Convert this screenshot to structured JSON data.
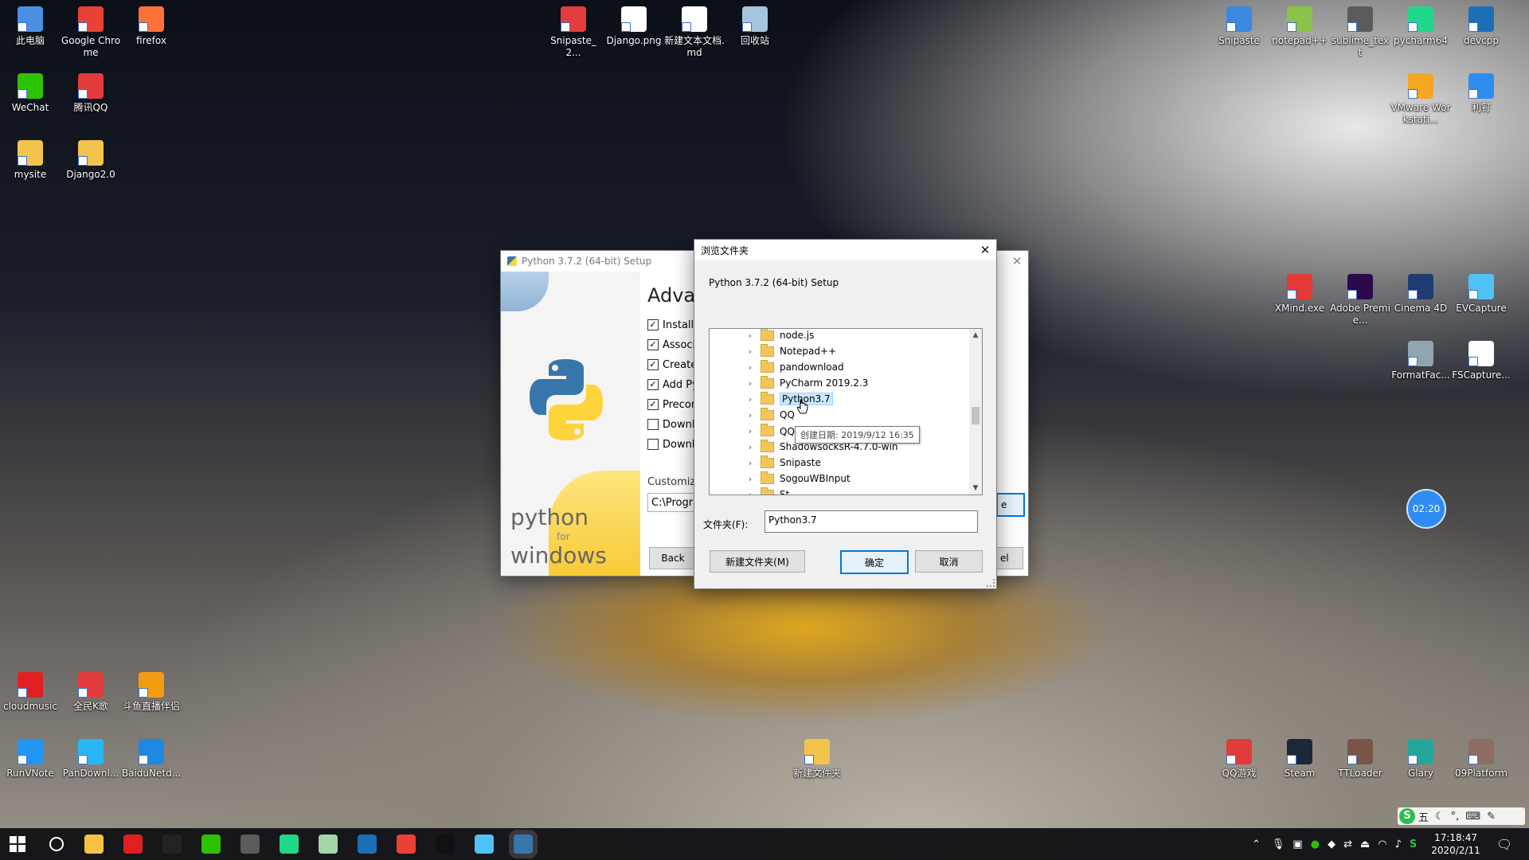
{
  "desktop": {
    "left_icons": [
      {
        "label": "此电脑",
        "color": "#4a90e2"
      },
      {
        "label": "Google Chrome",
        "color": "#e94235"
      },
      {
        "label": "firefox",
        "color": "#ff7139"
      },
      {
        "label": "WeChat",
        "color": "#2dc100"
      },
      {
        "label": "腾讯QQ",
        "color": "#e23b3b"
      },
      {
        "label": "mysite",
        "color": "#f2c44c"
      },
      {
        "label": "Django2.0",
        "color": "#f2c44c"
      }
    ],
    "center_icons": [
      {
        "label": "Snipaste_2...",
        "color": "#e33c3c"
      },
      {
        "label": "Django.png",
        "color": "#ffffff"
      },
      {
        "label": "新建文本文档.md",
        "color": "#ffffff"
      },
      {
        "label": "回收站",
        "color": "#a7c4de"
      }
    ],
    "right_top_icons": [
      {
        "label": "Snipaste",
        "color": "#3a88e0"
      },
      {
        "label": "notepad++",
        "color": "#8bc34a"
      },
      {
        "label": "sublime_text",
        "color": "#5b5b5b"
      },
      {
        "label": "pycharm64",
        "color": "#21d789"
      },
      {
        "label": "devcpp",
        "color": "#1b6fb5"
      },
      {
        "label": "VMware Workstati...",
        "color": "#f5a623"
      },
      {
        "label": "利钉",
        "color": "#2f8cf0"
      }
    ],
    "right_mid_icons": [
      {
        "label": "XMind.exe",
        "color": "#e53935"
      },
      {
        "label": "Adobe Premie...",
        "color": "#2a0a4a"
      },
      {
        "label": "Cinema 4D",
        "color": "#1e3c72"
      },
      {
        "label": "EVCapture",
        "color": "#4fc3f7"
      },
      {
        "label": "FormatFac...",
        "color": "#90a4ae"
      },
      {
        "label": "FSCapture...",
        "color": "#ffffff"
      }
    ],
    "bottom_left_icons": [
      {
        "label": "cloudmusic",
        "color": "#e02020"
      },
      {
        "label": "全民K歌",
        "color": "#e23b3b"
      },
      {
        "label": "斗鱼直播伴侣",
        "color": "#f39c12"
      },
      {
        "label": "RunVNote",
        "color": "#2196f3"
      },
      {
        "label": "PanDownl...",
        "color": "#29b6f6"
      },
      {
        "label": "BaiduNetd...",
        "color": "#1e88e5"
      }
    ],
    "bottom_mid_icons": [
      {
        "label": "新建文件夹",
        "color": "#f2c44c"
      }
    ],
    "bottom_right_icons": [
      {
        "label": "QQ游戏",
        "color": "#e23b3b"
      },
      {
        "label": "Steam",
        "color": "#1b2838"
      },
      {
        "label": "TTLoader",
        "color": "#795548"
      },
      {
        "label": "Glary",
        "color": "#26a69a"
      },
      {
        "label": "09Platform",
        "color": "#8d6e63"
      }
    ],
    "timer_badge": "02:20"
  },
  "setup_window": {
    "title": "Python 3.7.2 (64-bit) Setup",
    "heading": "Adva",
    "options": [
      {
        "label": "Install f",
        "checked": true
      },
      {
        "label": "Associa",
        "checked": true
      },
      {
        "label": "Create",
        "checked": true
      },
      {
        "label": "Add Py",
        "checked": true
      },
      {
        "label": "Precon",
        "checked": true
      },
      {
        "label": "Downlo",
        "checked": false
      },
      {
        "label": "Downlo",
        "checked": false
      }
    ],
    "custom_label": "Customiz",
    "path_value": "C:\\Progra",
    "back_button": "Back",
    "brand_python": "python",
    "brand_for": "for",
    "brand_windows": "windows",
    "right_btn1": "e",
    "right_btn2": "el"
  },
  "browse_dialog": {
    "title": "浏览文件夹",
    "description": "Python 3.7.2 (64-bit) Setup",
    "folders": [
      {
        "label": "node.js",
        "selected": false
      },
      {
        "label": "Notepad++",
        "selected": false
      },
      {
        "label": "pandownload",
        "selected": false
      },
      {
        "label": "PyCharm 2019.2.3",
        "selected": false
      },
      {
        "label": "Python3.7",
        "selected": true
      },
      {
        "label": "QQ",
        "selected": false
      },
      {
        "label": "QQ游",
        "selected": false
      },
      {
        "label": "ShadowsocksR-4.7.0-win",
        "selected": false
      },
      {
        "label": "Snipaste",
        "selected": false
      },
      {
        "label": "SogouWBInput",
        "selected": false
      },
      {
        "label": "St",
        "selected": false
      }
    ],
    "tooltip": "创建日期: 2019/9/12 16:35",
    "folder_label": "文件夹(F):",
    "folder_value": "Python3.7",
    "new_folder_button": "新建文件夹(M)",
    "ok_button": "确定",
    "cancel_button": "取消"
  },
  "taskbar": {
    "apps": [
      {
        "name": "start",
        "color": "#ffffff"
      },
      {
        "name": "search",
        "color": "#ffffff"
      },
      {
        "name": "file-explorer",
        "color": "#f5c242"
      },
      {
        "name": "cloudmusic",
        "color": "#e02020"
      },
      {
        "name": "qq",
        "color": "#222222"
      },
      {
        "name": "wechat",
        "color": "#2dc100"
      },
      {
        "name": "sublime",
        "color": "#5b5b5b"
      },
      {
        "name": "pycharm",
        "color": "#21d789"
      },
      {
        "name": "app-flower",
        "color": "#a5d6a7"
      },
      {
        "name": "devcpp",
        "color": "#1b6fb5"
      },
      {
        "name": "chrome",
        "color": "#e94235"
      },
      {
        "name": "terminal",
        "color": "#111111"
      },
      {
        "name": "remote",
        "color": "#4fc3f7"
      },
      {
        "name": "python-setup",
        "color": "#3776ab"
      }
    ],
    "ime": "五",
    "time": "17:18:47",
    "date": "2020/2/11"
  }
}
